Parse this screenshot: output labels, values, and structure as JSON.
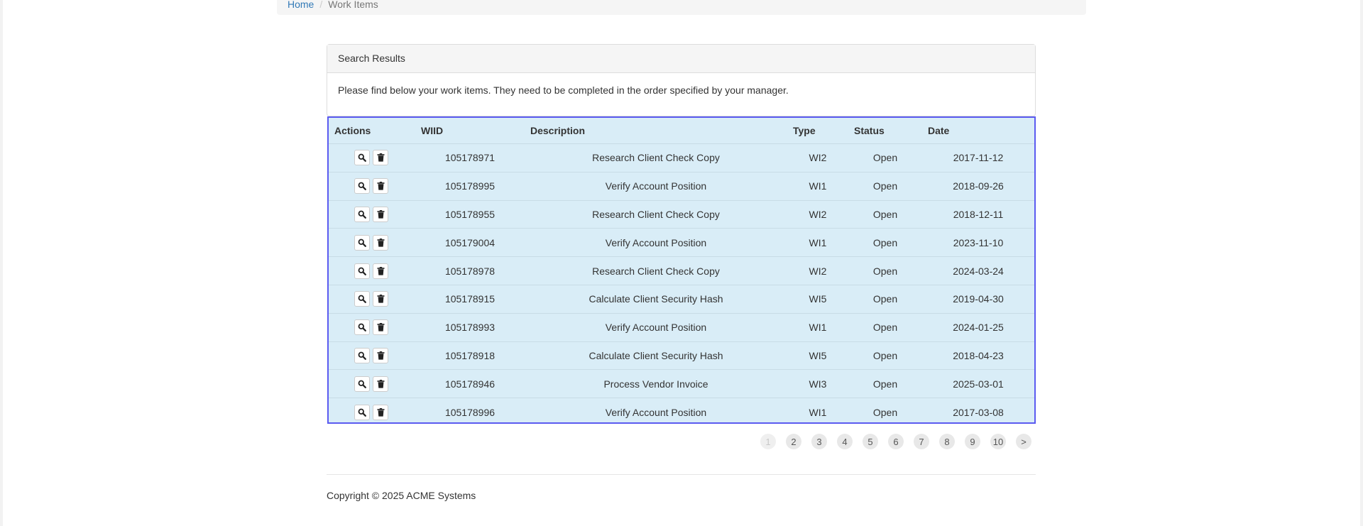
{
  "breadcrumb": {
    "home": "Home",
    "separator": "/",
    "current": "Work Items"
  },
  "panel": {
    "heading": "Search Results",
    "intro": "Please find below your work items. They need to be completed in the order specified by your manager."
  },
  "table": {
    "headers": [
      "Actions",
      "WIID",
      "Description",
      "Type",
      "Status",
      "Date"
    ],
    "rows": [
      {
        "wiid": "105178971",
        "description": "Research Client Check Copy",
        "type": "WI2",
        "status": "Open",
        "date": "2017-11-12"
      },
      {
        "wiid": "105178995",
        "description": "Verify Account Position",
        "type": "WI1",
        "status": "Open",
        "date": "2018-09-26"
      },
      {
        "wiid": "105178955",
        "description": "Research Client Check Copy",
        "type": "WI2",
        "status": "Open",
        "date": "2018-12-11"
      },
      {
        "wiid": "105179004",
        "description": "Verify Account Position",
        "type": "WI1",
        "status": "Open",
        "date": "2023-11-10"
      },
      {
        "wiid": "105178978",
        "description": "Research Client Check Copy",
        "type": "WI2",
        "status": "Open",
        "date": "2024-03-24"
      },
      {
        "wiid": "105178915",
        "description": "Calculate Client Security Hash",
        "type": "WI5",
        "status": "Open",
        "date": "2019-04-30"
      },
      {
        "wiid": "105178993",
        "description": "Verify Account Position",
        "type": "WI1",
        "status": "Open",
        "date": "2024-01-25"
      },
      {
        "wiid": "105178918",
        "description": "Calculate Client Security Hash",
        "type": "WI5",
        "status": "Open",
        "date": "2018-04-23"
      },
      {
        "wiid": "105178946",
        "description": "Process Vendor Invoice",
        "type": "WI3",
        "status": "Open",
        "date": "2025-03-01"
      },
      {
        "wiid": "105178996",
        "description": "Verify Account Position",
        "type": "WI1",
        "status": "Open",
        "date": "2017-03-08"
      }
    ]
  },
  "pagination": {
    "pages": [
      "1",
      "2",
      "3",
      "4",
      "5",
      "6",
      "7",
      "8",
      "9",
      "10"
    ],
    "current": "1",
    "next": ">"
  },
  "footer": {
    "copyright": "Copyright © 2025 ACME Systems"
  },
  "icons": {
    "view": "search-icon",
    "delete": "trash-icon"
  },
  "colors": {
    "link": "#337ab7",
    "table_bg": "#d9edf7",
    "table_border": "#5b5bf0"
  }
}
